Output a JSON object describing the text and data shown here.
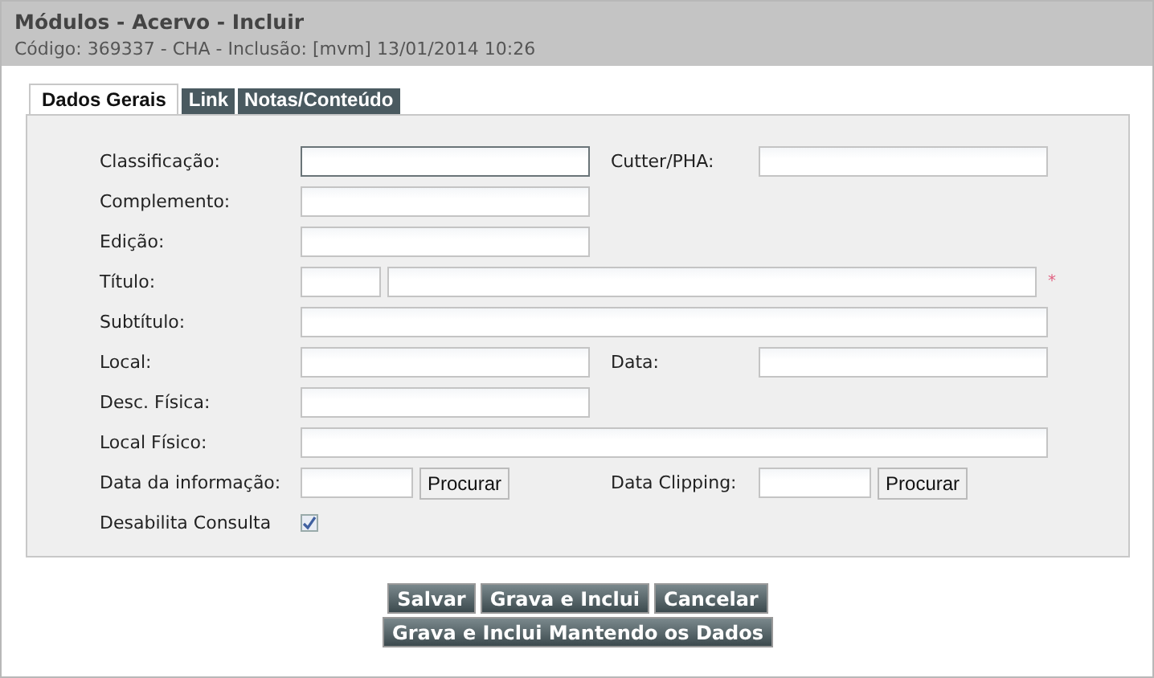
{
  "header": {
    "title": "Módulos - Acervo - Incluir",
    "subtitle": "Código: 369337 - CHA - Inclusão: [mvm] 13/01/2014 10:26"
  },
  "tabs": [
    {
      "label": "Dados Gerais",
      "selected": true
    },
    {
      "label": "Link",
      "selected": false
    },
    {
      "label": "Notas/Conteúdo",
      "selected": false
    }
  ],
  "rows": [
    {
      "kind": "text",
      "label": "Classificação:",
      "focused": true,
      "right": {
        "label": "Cutter/PHA:"
      }
    },
    {
      "kind": "text",
      "label": "Complemento:",
      "focused": false
    },
    {
      "kind": "text",
      "label": "Edição:",
      "focused": false
    },
    {
      "kind": "title",
      "label": "Título:",
      "required_mark": "*"
    },
    {
      "kind": "wide",
      "label": "Subtítulo:"
    },
    {
      "kind": "text",
      "label": "Local:",
      "focused": false,
      "right": {
        "label": "Data:"
      }
    },
    {
      "kind": "text",
      "label": "Desc. Física:",
      "focused": false
    },
    {
      "kind": "wide",
      "label": "Local Físico:"
    },
    {
      "kind": "date",
      "label": "Data da informação:",
      "button": "Procurar",
      "right": {
        "label": "Data Clipping:",
        "button": "Procurar"
      }
    },
    {
      "kind": "checkbox",
      "label": "Desabilita Consulta",
      "checked": true
    }
  ],
  "buttons": [
    [
      "Salvar",
      "Grava e Inclui",
      "Cancelar"
    ],
    [
      "Grava e Inclui Mantendo os Dados"
    ]
  ]
}
